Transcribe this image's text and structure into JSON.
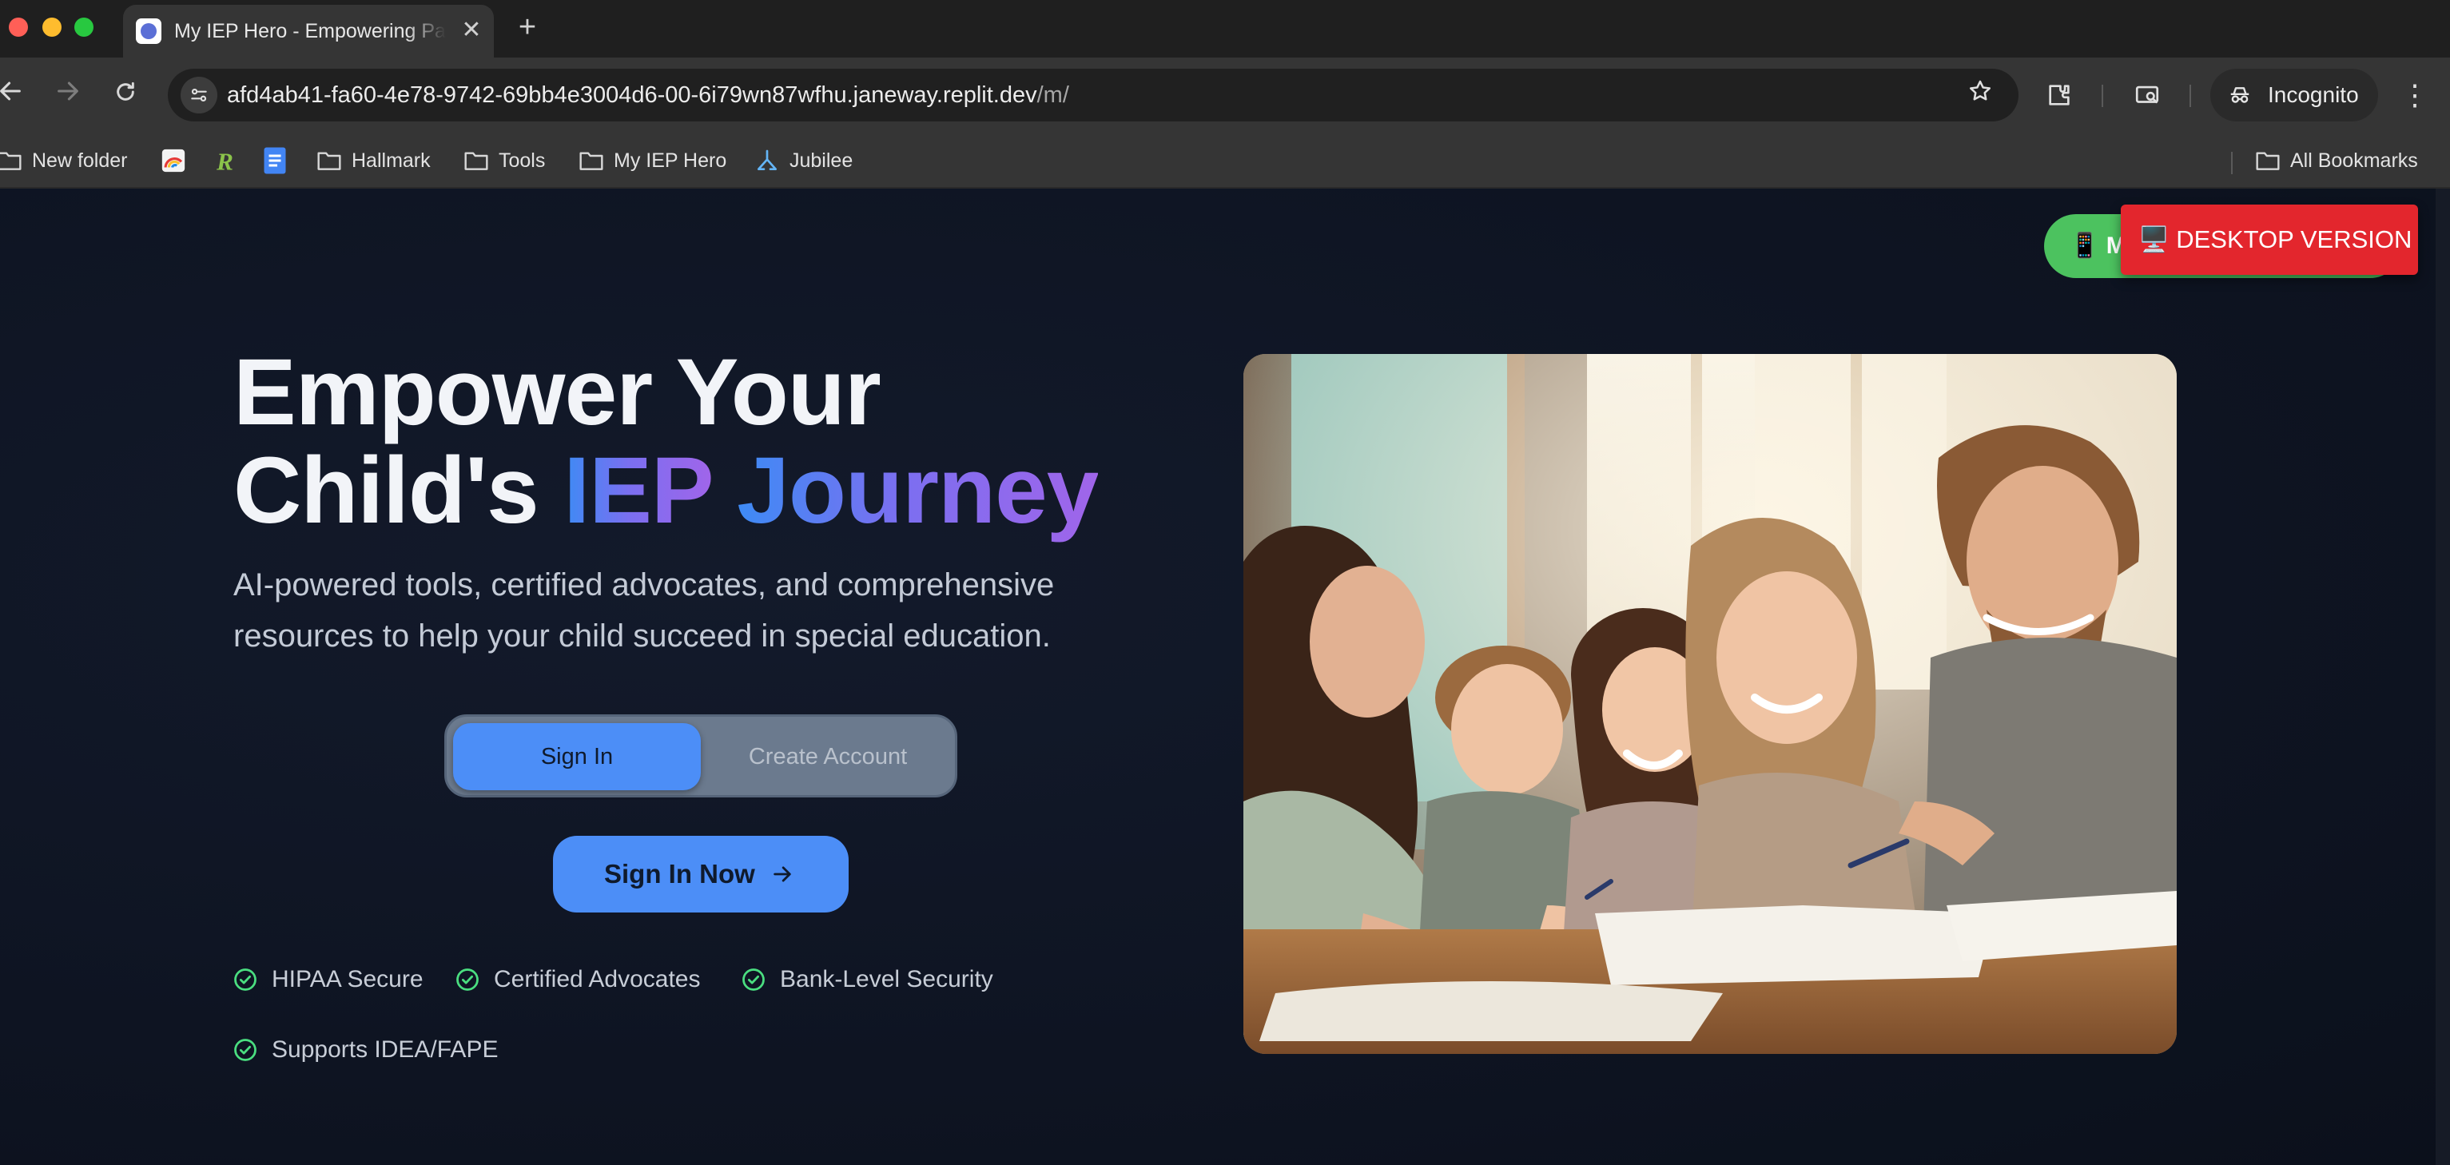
{
  "browser": {
    "tab": {
      "title": "My IEP Hero - Empowering Parents",
      "close_glyph": "✕",
      "favicon": "app-logo-icon"
    },
    "new_tab_glyph": "+",
    "url": {
      "host": "afd4ab41-fa60-4e78-9742-69bb4e3004d6-00-6i79wn87wfhu.janeway.replit.dev",
      "path": "/m/"
    },
    "profile_label": "Incognito",
    "icons": [
      "back-icon",
      "forward-icon",
      "reload-icon",
      "site-info-icon",
      "star-icon",
      "extensions-icon",
      "cast-icon",
      "incognito-icon",
      "menu-icon"
    ],
    "bookmarks": [
      {
        "label": "New folder",
        "icon": "folder-icon"
      },
      {
        "label": "",
        "icon": "rainbow-bookmark-icon"
      },
      {
        "label": "",
        "icon": "r-logo-icon"
      },
      {
        "label": "",
        "icon": "docs-icon"
      },
      {
        "label": "Hallmark",
        "icon": "folder-icon"
      },
      {
        "label": "Tools",
        "icon": "folder-icon"
      },
      {
        "label": "My IEP Hero",
        "icon": "folder-icon"
      },
      {
        "label": "Jubilee",
        "icon": "jubilee-icon"
      }
    ],
    "all_bookmarks_label": "All Bookmarks"
  },
  "view_switch": {
    "mobile_label": "📱 Mobile Version",
    "desktop_label": "🖥️ DESKTOP VERSION",
    "colors": {
      "mobile": "#4cc25f",
      "desktop": "#e3262d"
    }
  },
  "hero": {
    "title_line1": "Empower Your",
    "title_line2_prefix": "Child's ",
    "title_highlight_1": "IEP",
    "title_highlight_2": "Journey",
    "subtitle": "AI-powered tools, certified advocates, and comprehensive resources to help your child succeed in special education.",
    "auth_tabs": {
      "active": "Sign In",
      "inactive": "Create Account"
    },
    "cta_label": "Sign In Now",
    "features": [
      "HIPAA Secure",
      "Certified Advocates",
      "Bank-Level Security",
      "Supports IDEA/FAPE"
    ],
    "accent_colors": {
      "blue": "#4c8ef7",
      "purple": "#a065ea",
      "check_green": "#4ade80"
    }
  }
}
